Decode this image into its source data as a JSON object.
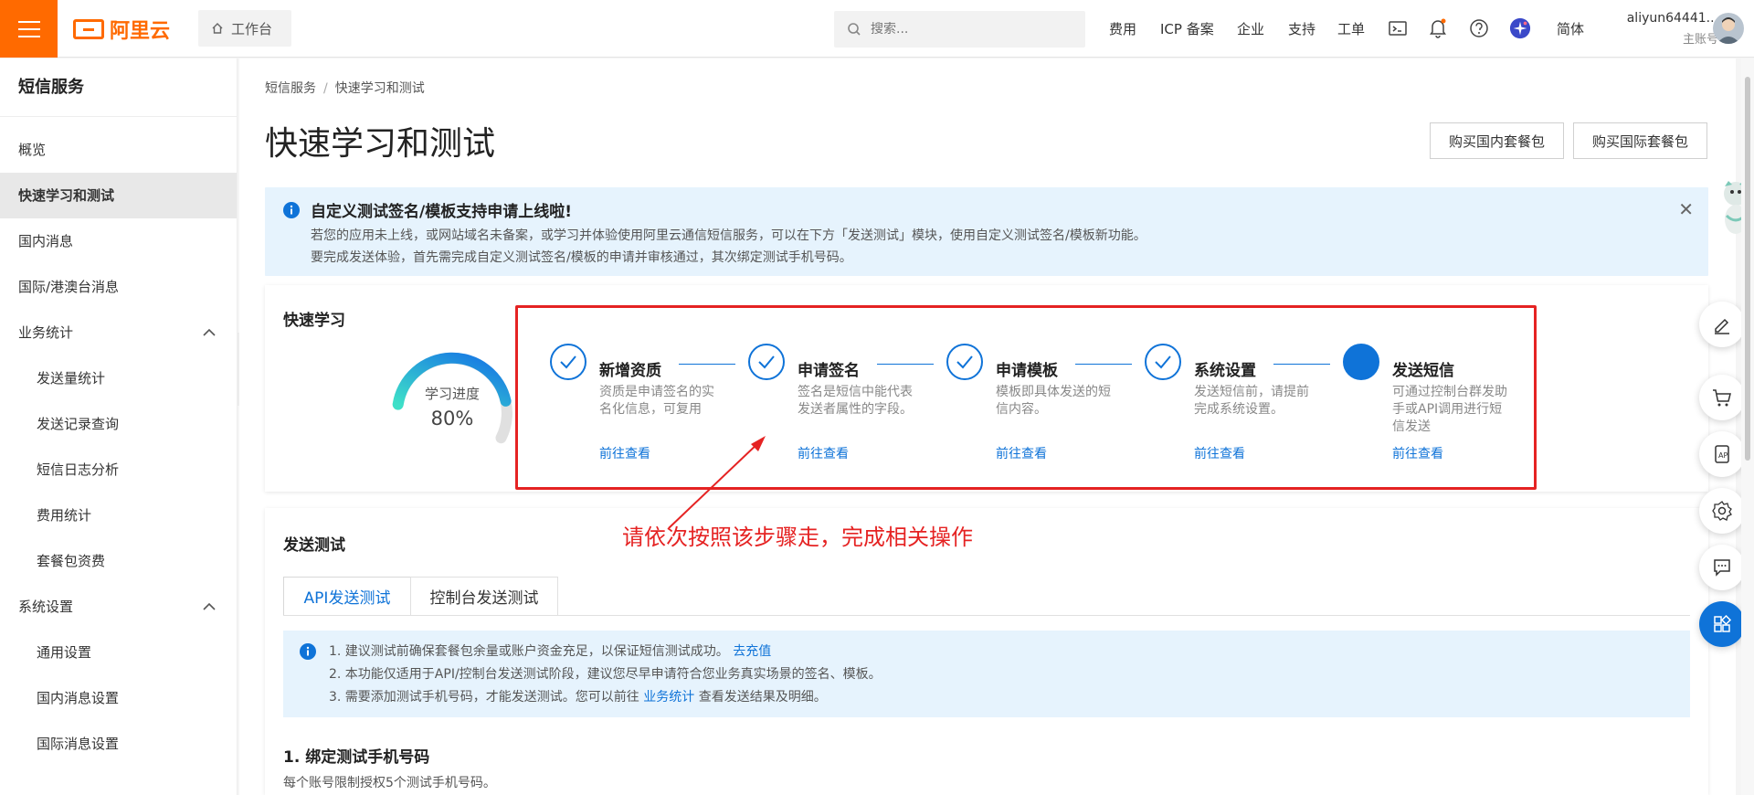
{
  "header": {
    "logo_text": "阿里云",
    "workbench": "工作台",
    "search_placeholder": "搜索...",
    "nav": [
      "费用",
      "ICP 备案",
      "企业",
      "支持",
      "工单"
    ],
    "lang": "简体",
    "username": "aliyun64441...",
    "account_type": "主账号"
  },
  "sidebar": {
    "title": "短信服务",
    "items": [
      {
        "label": "概览"
      },
      {
        "label": "快速学习和测试"
      },
      {
        "label": "国内消息"
      },
      {
        "label": "国际/港澳台消息"
      },
      {
        "label": "业务统计"
      },
      {
        "label": "发送量统计"
      },
      {
        "label": "发送记录查询"
      },
      {
        "label": "短信日志分析"
      },
      {
        "label": "费用统计"
      },
      {
        "label": "套餐包资费"
      },
      {
        "label": "系统设置"
      },
      {
        "label": "通用设置"
      },
      {
        "label": "国内消息设置"
      },
      {
        "label": "国际消息设置"
      }
    ]
  },
  "page": {
    "breadcrumb": [
      "短信服务",
      "快速学习和测试"
    ],
    "title": "快速学习和测试",
    "buy_domestic": "购买国内套餐包",
    "buy_intl": "购买国际套餐包"
  },
  "notice": {
    "heading": "自定义测试签名/模板支持申请上线啦!",
    "line1": "若您的应用未上线，或网站域名未备案，或学习并体验使用阿里云通信短信服务，可以在下方「发送测试」模块，使用自定义测试签名/模板新功能。",
    "line2": "要完成发送体验，首先需完成自定义测试签名/模板的申请并审核通过，其次绑定测试手机号码。"
  },
  "quick": {
    "title": "快速学习",
    "progress_label": "学习进度",
    "progress": 0.8,
    "progress_text": "80%",
    "steps": [
      {
        "name": "新增资质",
        "desc": "资质是申请签名的实名化信息，可复用",
        "link": "前往查看",
        "done": true
      },
      {
        "name": "申请签名",
        "desc": "签名是短信中能代表发送者属性的字段。",
        "link": "前往查看",
        "done": true
      },
      {
        "name": "申请模板",
        "desc": "模板即具体发送的短信内容。",
        "link": "前往查看",
        "done": true
      },
      {
        "name": "系统设置",
        "desc": "发送短信前，请提前完成系统设置。",
        "link": "前往查看",
        "done": true
      },
      {
        "name": "发送短信",
        "desc": "可通过控制台群发助手或API调用进行短信发送",
        "link": "前往查看",
        "done": false
      }
    ]
  },
  "annotation": "请依次按照该步骤走，完成相关操作",
  "send_test": {
    "title": "发送测试",
    "tabs": [
      "API发送测试",
      "控制台发送测试"
    ],
    "tips": {
      "t1": "1. 建议测试前确保套餐包余量或账户资金充足，以保证短信测试成功。",
      "t1_link": "去充值",
      "t2": "2. 本功能仅适用于API/控制台发送测试阶段，建议您尽早申请符合您业务真实场景的签名、模板。",
      "t3_a": "3. 需要添加测试手机号码，才能发送测试。您可以前往",
      "t3_link": "业务统计",
      "t3_b": "查看发送结果及明细。"
    },
    "bind_title": "1. 绑定测试手机号码",
    "bind_sub": "每个账号限制授权5个测试手机号码。"
  },
  "colors": {
    "brand": "#ff6a00",
    "primary": "#0f73d8",
    "alert": "#e52323"
  }
}
